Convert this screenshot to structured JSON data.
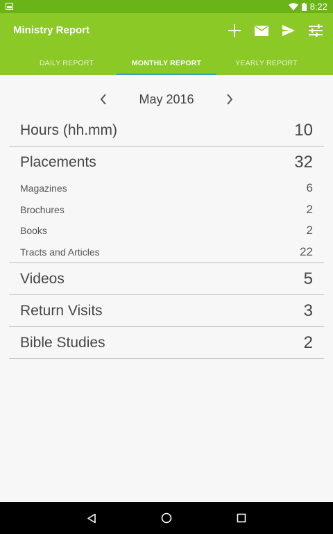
{
  "status_bar": {
    "time": "8:22",
    "icons": [
      "image-icon",
      "wifi-icon",
      "battery-icon"
    ]
  },
  "app_bar": {
    "title": "Ministry Report",
    "actions": [
      "add-icon",
      "mail-icon",
      "send-icon",
      "settings-sliders-icon"
    ]
  },
  "tabs": [
    {
      "label": "DAILY REPORT",
      "active": false
    },
    {
      "label": "MONTHLY REPORT",
      "active": true
    },
    {
      "label": "YEARLY REPORT",
      "active": false
    }
  ],
  "month_nav": {
    "label": "May 2016",
    "prev_icon": "chevron-left-icon",
    "next_icon": "chevron-right-icon"
  },
  "report": {
    "hours": {
      "label": "Hours (hh.mm)",
      "value": "10"
    },
    "placements": {
      "label": "Placements",
      "value": "32"
    },
    "magazines": {
      "label": "Magazines",
      "value": "6"
    },
    "brochures": {
      "label": "Brochures",
      "value": "2"
    },
    "books": {
      "label": "Books",
      "value": "2"
    },
    "tracts": {
      "label": "Tracts and Articles",
      "value": "22"
    },
    "videos": {
      "label": "Videos",
      "value": "5"
    },
    "return_visits": {
      "label": "Return Visits",
      "value": "3"
    },
    "bible_studies": {
      "label": "Bible Studies",
      "value": "2"
    }
  },
  "colors": {
    "app_bar": "#8bc926",
    "status_bar": "#6bb418",
    "tab_indicator": "#2aa3c2",
    "background": "#f7f7f7"
  },
  "nav_bar": [
    "back-icon",
    "home-icon",
    "recents-icon"
  ]
}
